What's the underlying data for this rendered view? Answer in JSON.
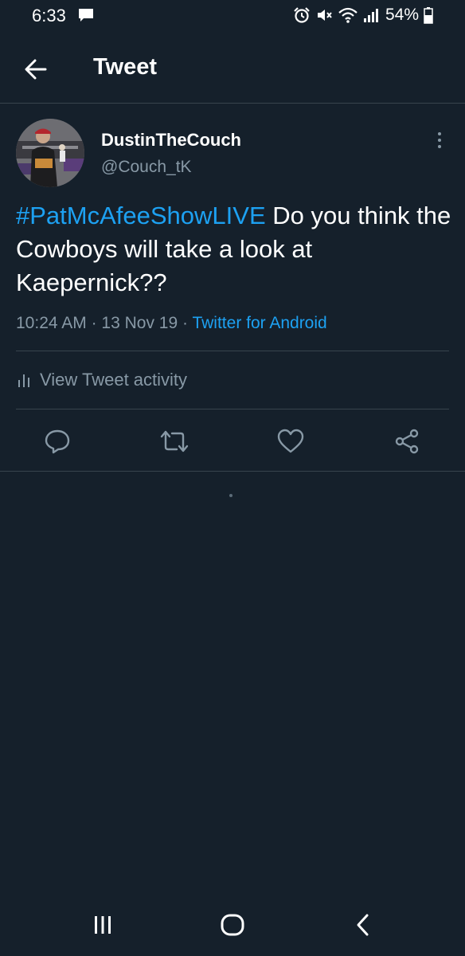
{
  "status_bar": {
    "time": "6:33",
    "battery": "54%",
    "icons": [
      "message-icon",
      "alarm-icon",
      "mute-icon",
      "wifi-icon",
      "signal-icon",
      "battery-icon"
    ]
  },
  "header": {
    "title": "Tweet",
    "back_icon": "arrow-left-icon"
  },
  "tweet": {
    "author": {
      "display_name": "DustinTheCouch",
      "handle": "@Couch_tK"
    },
    "hashtag": "#PatMcAfeeShowLIVE",
    "text": " Do you think the Cowboys will take a look at Kaepernick??",
    "time": "10:24 AM",
    "separator": "·",
    "date": "13 Nov 19",
    "source": "Twitter for Android",
    "activity_label": "View Tweet activity"
  },
  "actions": [
    "reply-icon",
    "retweet-icon",
    "like-icon",
    "share-icon"
  ],
  "nav_bar": [
    "recents-icon",
    "home-icon",
    "back-icon"
  ],
  "colors": {
    "background": "#15202b",
    "divider": "#38444d",
    "text_primary": "#ffffff",
    "text_secondary": "#8899a6",
    "accent": "#1da1f2"
  }
}
